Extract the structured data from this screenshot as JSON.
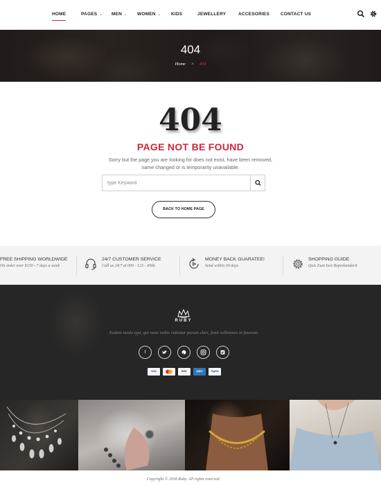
{
  "nav": {
    "items": [
      {
        "label": "HOME"
      },
      {
        "label": "PAGES"
      },
      {
        "label": "MEN"
      },
      {
        "label": "WOMEN"
      },
      {
        "label": "KIDS"
      },
      {
        "label": "JEWELLERY"
      },
      {
        "label": "ACCESORIES"
      },
      {
        "label": "CONTACT US"
      }
    ],
    "accent": "#d0263a"
  },
  "hero": {
    "title": "404",
    "breadcrumb_home": "Home",
    "breadcrumb_sep": ">",
    "breadcrumb_current": "404"
  },
  "main": {
    "code": "404",
    "title": "PAGE NOT BE FOUND",
    "text": "Sorry but the page you are looking for does not exist, have been removed, name changed or is temporarity unavailable.",
    "search_placeholder": "type Keyword",
    "back_label": "BACK TO HOME PAGE"
  },
  "services": [
    {
      "title": "FREE SHIPPING WORLDWIDE",
      "sub": "On order over $150 - 7 days a week"
    },
    {
      "title": "24/7 CUSTOMER SERVICE",
      "sub": "Call us 24/7 at 000 - 123 - 456k"
    },
    {
      "title": "MONEY BACK GUARATEE!",
      "sub": "Send within 30 days"
    },
    {
      "title": "SHOPPING GUIDE",
      "sub": "Quis Eum Iure Reprehenderit"
    }
  ],
  "footer": {
    "logo_text": "RUBY",
    "tagline": "Eodem modo typi, qui nunc nobis videntur parum clari, fiant sollemnes in futurum",
    "payments": [
      "VISA",
      "MC",
      "DISC",
      "AMEX",
      "PayPal"
    ],
    "copyright": "Copyright © 2018 Ruby. All rights reserved."
  }
}
